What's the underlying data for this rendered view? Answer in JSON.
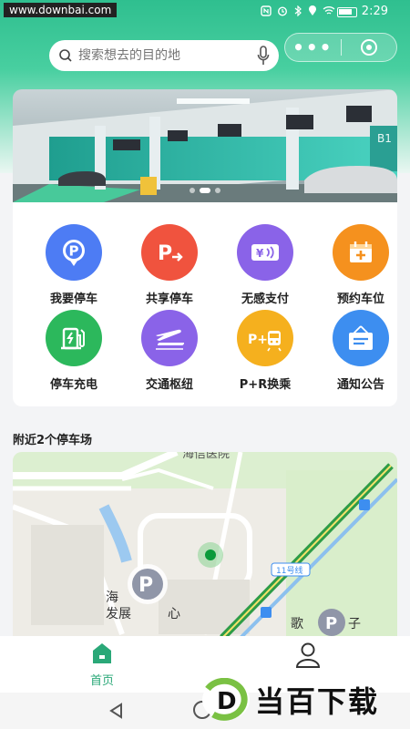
{
  "status_bar": {
    "watermark": "www.downbai.com",
    "time": "2:29",
    "icons": [
      "nfc-icon",
      "alarm-icon",
      "bluetooth-icon",
      "location-icon",
      "wifi-icon",
      "battery-icon"
    ]
  },
  "search": {
    "placeholder": "搜索想去的目的地"
  },
  "banner": {
    "sign_text": "B1",
    "slides": 3,
    "active_slide": 2
  },
  "functions": [
    {
      "label": "我要停车",
      "icon": "parking-pin-icon",
      "color": "#4d7cf4"
    },
    {
      "label": "共享停车",
      "icon": "share-parking-icon",
      "color": "#f0533e"
    },
    {
      "label": "无感支付",
      "icon": "contactless-pay-icon",
      "color": "#8a63e8"
    },
    {
      "label": "预约车位",
      "icon": "calendar-plus-icon",
      "color": "#f5911e"
    },
    {
      "label": "停车充电",
      "icon": "ev-charger-icon",
      "color": "#2cb85c"
    },
    {
      "label": "交通枢纽",
      "icon": "plane-train-icon",
      "color": "#8a63e8"
    },
    {
      "label": "P+R换乘",
      "icon": "park-ride-icon",
      "color": "#f5b01e"
    },
    {
      "label": "通知公告",
      "icon": "notice-board-icon",
      "color": "#3d8ef0"
    }
  ],
  "nearby": {
    "title": "附近2个停车场"
  },
  "map": {
    "labels": {
      "hospital": "海信医院",
      "center": "海",
      "center2": "发展",
      "center3": "心",
      "line": "11号线",
      "park2": "歌",
      "park2b": "子"
    }
  },
  "tabbar": {
    "home_label": "首页"
  },
  "brand": {
    "text": "当百下载",
    "letter": "D"
  },
  "colors": {
    "accent": "#2fbf8f",
    "tab_active": "#2aa878"
  }
}
